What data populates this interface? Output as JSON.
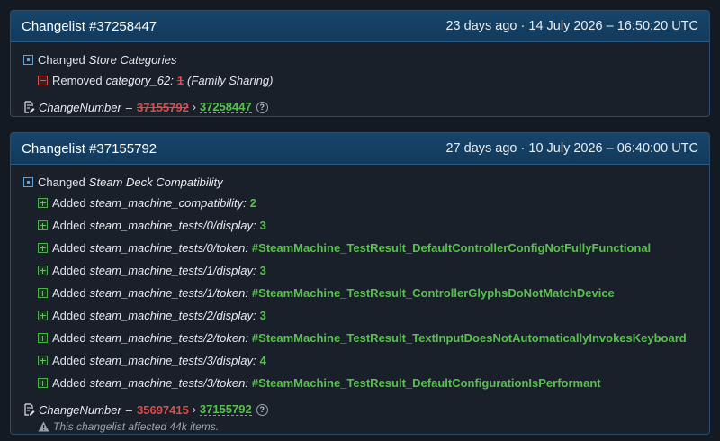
{
  "changelists": [
    {
      "title": "Changelist #37258447",
      "date": "23 days ago · 14 July 2026 – 16:50:20 UTC",
      "changed_label": "Changed",
      "section": "Store Categories",
      "removed": {
        "action": "Removed",
        "key": "category_62:",
        "old_value": "1",
        "note": "(Family Sharing)"
      },
      "change_number": {
        "label": "ChangeNumber",
        "separator": "–",
        "old": "37155792",
        "arrow": "›",
        "new": "37258447",
        "help": "?"
      }
    },
    {
      "title": "Changelist #37155792",
      "date": "27 days ago · 10 July 2026 – 06:40:00 UTC",
      "changed_label": "Changed",
      "section": "Steam Deck Compatibility",
      "added": [
        {
          "action": "Added",
          "key": "steam_machine_compatibility:",
          "value": "2"
        },
        {
          "action": "Added",
          "key": "steam_machine_tests/0/display:",
          "value": "3"
        },
        {
          "action": "Added",
          "key": "steam_machine_tests/0/token:",
          "value": "#SteamMachine_TestResult_DefaultControllerConfigNotFullyFunctional"
        },
        {
          "action": "Added",
          "key": "steam_machine_tests/1/display:",
          "value": "3"
        },
        {
          "action": "Added",
          "key": "steam_machine_tests/1/token:",
          "value": "#SteamMachine_TestResult_ControllerGlyphsDoNotMatchDevice"
        },
        {
          "action": "Added",
          "key": "steam_machine_tests/2/display:",
          "value": "3"
        },
        {
          "action": "Added",
          "key": "steam_machine_tests/2/token:",
          "value": "#SteamMachine_TestResult_TextInputDoesNotAutomaticallyInvokesKeyboard"
        },
        {
          "action": "Added",
          "key": "steam_machine_tests/3/display:",
          "value": "4"
        },
        {
          "action": "Added",
          "key": "steam_machine_tests/3/token:",
          "value": "#SteamMachine_TestResult_DefaultConfigurationIsPerformant"
        }
      ],
      "change_number": {
        "label": "ChangeNumber",
        "separator": "–",
        "old": "35697415",
        "arrow": "›",
        "new": "37155792",
        "help": "?"
      },
      "warning": "This changelist affected 44k items."
    }
  ],
  "colors": {
    "added": "#58c14e",
    "removed": "#e04b4b",
    "header": "#17456b"
  }
}
